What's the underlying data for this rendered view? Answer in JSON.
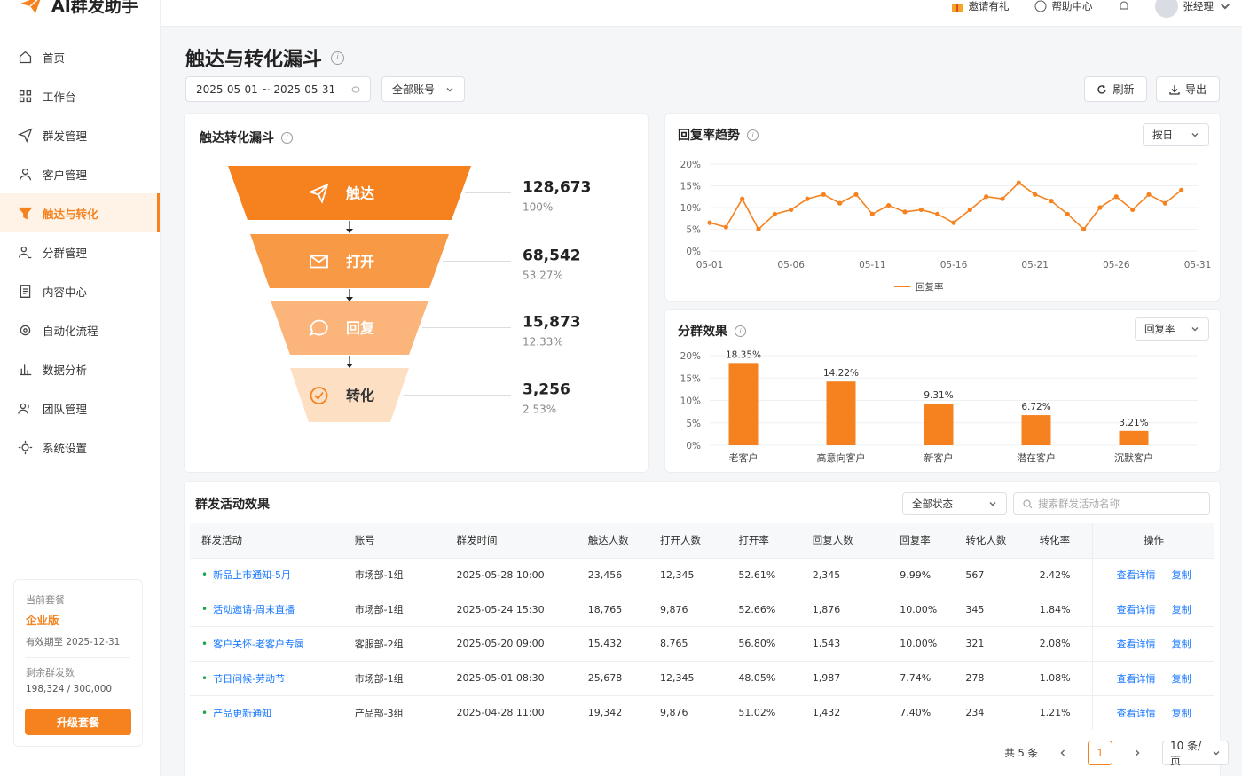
{
  "app": {
    "name": "AI群发助手",
    "brand_color": "#f5821f"
  },
  "header": {
    "invite": "邀请有礼",
    "help": "帮助中心",
    "user": "张经理"
  },
  "sidebar": {
    "items": [
      {
        "label": "首页",
        "icon": "home-icon"
      },
      {
        "label": "工作台",
        "icon": "grid-icon"
      },
      {
        "label": "群发管理",
        "icon": "send-icon"
      },
      {
        "label": "客户管理",
        "icon": "user-icon"
      },
      {
        "label": "触达与转化",
        "icon": "funnel-icon",
        "active": true
      },
      {
        "label": "分群管理",
        "icon": "users-icon"
      },
      {
        "label": "内容中心",
        "icon": "document-icon"
      },
      {
        "label": "自动化流程",
        "icon": "automation-icon"
      },
      {
        "label": "数据分析",
        "icon": "bar-chart-icon"
      },
      {
        "label": "团队管理",
        "icon": "team-icon"
      },
      {
        "label": "系统设置",
        "icon": "settings-icon"
      }
    ],
    "plan": {
      "label": "当前套餐",
      "name": "企业版",
      "valid": "有效期至 2025-12-31",
      "remaining_label": "剩余群发数",
      "remaining": "198,324 / 300,000",
      "upgrade": "升级套餐"
    }
  },
  "page": {
    "title": "触达与转化漏斗",
    "date_range": "2025-05-01 ~ 2025-05-31",
    "account_filter": "全部账号",
    "refresh": "刷新",
    "export": "导出"
  },
  "funnel": {
    "title": "触达转化漏斗",
    "stages": [
      {
        "label": "触达",
        "value": "128,673",
        "pct": "100%",
        "color": "#f5821f",
        "icon": "send-icon"
      },
      {
        "label": "打开",
        "value": "68,542",
        "pct": "53.27%",
        "color": "#f89a45",
        "icon": "mail-icon"
      },
      {
        "label": "回复",
        "value": "15,873",
        "pct": "12.33%",
        "color": "#fbb47a",
        "icon": "chat-icon"
      },
      {
        "label": "转化",
        "value": "3,256",
        "pct": "2.53%",
        "color": "#fde0c4",
        "icon": "check-circle-icon"
      }
    ]
  },
  "trend": {
    "title": "回复率趋势",
    "granularity": "按日",
    "legend": "回复率",
    "color": "#f5821f"
  },
  "segment": {
    "title": "分群效果",
    "metric": "回复率",
    "color": "#f5821f"
  },
  "chart_data": [
    {
      "type": "line",
      "title": "回复率趋势",
      "x": [
        "05-01",
        "05-02",
        "05-03",
        "05-04",
        "05-05",
        "05-06",
        "05-07",
        "05-08",
        "05-09",
        "05-10",
        "05-11",
        "05-12",
        "05-13",
        "05-14",
        "05-15",
        "05-16",
        "05-17",
        "05-18",
        "05-19",
        "05-20",
        "05-21",
        "05-22",
        "05-23",
        "05-24",
        "05-25",
        "05-26",
        "05-27",
        "05-28",
        "05-29",
        "05-30",
        "05-31"
      ],
      "xticks": [
        "05-01",
        "05-06",
        "05-11",
        "05-16",
        "05-21",
        "05-26",
        "05-31"
      ],
      "yticks": [
        "0%",
        "5%",
        "10%",
        "15%",
        "20%"
      ],
      "series": [
        {
          "name": "回复率",
          "values": [
            6.5,
            5.5,
            12,
            5,
            8.5,
            9.5,
            12,
            13,
            11,
            13,
            8.5,
            10.5,
            9,
            9.5,
            8.5,
            6.5,
            9.5,
            12.5,
            12,
            15.7,
            13,
            11.5,
            8.5,
            5,
            10,
            12.5,
            9.5,
            13,
            11,
            14
          ]
        }
      ],
      "ylim": [
        0,
        20
      ],
      "legend": "bottom-center",
      "grid": "horizontal"
    },
    {
      "type": "bar",
      "title": "分群效果",
      "categories": [
        "老客户",
        "高意向客户",
        "新客户",
        "潜在客户",
        "沉默客户"
      ],
      "values": [
        18.35,
        14.22,
        9.31,
        6.72,
        3.21
      ],
      "labels": [
        "18.35%",
        "14.22%",
        "9.31%",
        "6.72%",
        "3.21%"
      ],
      "yticks": [
        "0%",
        "5%",
        "10%",
        "15%",
        "20%"
      ],
      "ylim": [
        0,
        20
      ],
      "grid": "horizontal"
    }
  ],
  "campaigns": {
    "title": "群发活动效果",
    "status_filter": "全部状态",
    "search_placeholder": "搜索群发活动名称",
    "columns": [
      "群发活动",
      "账号",
      "群发时间",
      "触达人数",
      "打开人数",
      "打开率",
      "回复人数",
      "回复率",
      "转化人数",
      "转化率",
      "操作"
    ],
    "rows": [
      [
        "新品上市通知-5月",
        "市场部-1组",
        "2025-05-28 10:00",
        "23,456",
        "12,345",
        "52.61%",
        "2,345",
        "9.99%",
        "567",
        "2.42%"
      ],
      [
        "活动邀请-周末直播",
        "市场部-1组",
        "2025-05-24 15:30",
        "18,765",
        "9,876",
        "52.66%",
        "1,876",
        "10.00%",
        "345",
        "1.84%"
      ],
      [
        "客户关怀-老客户专属",
        "客服部-2组",
        "2025-05-20 09:00",
        "15,432",
        "8,765",
        "56.80%",
        "1,543",
        "10.00%",
        "321",
        "2.08%"
      ],
      [
        "节日问候-劳动节",
        "市场部-1组",
        "2025-05-01 08:30",
        "25,678",
        "12,345",
        "48.05%",
        "1,987",
        "7.74%",
        "278",
        "1.08%"
      ],
      [
        "产品更新通知",
        "产品部-3组",
        "2025-04-28 11:00",
        "19,342",
        "9,876",
        "51.02%",
        "1,432",
        "7.40%",
        "234",
        "1.21%"
      ]
    ],
    "view_detail": "查看详情",
    "copy": "复制",
    "total": "共 5 条",
    "current_page": "1",
    "page_size": "10 条/页"
  }
}
